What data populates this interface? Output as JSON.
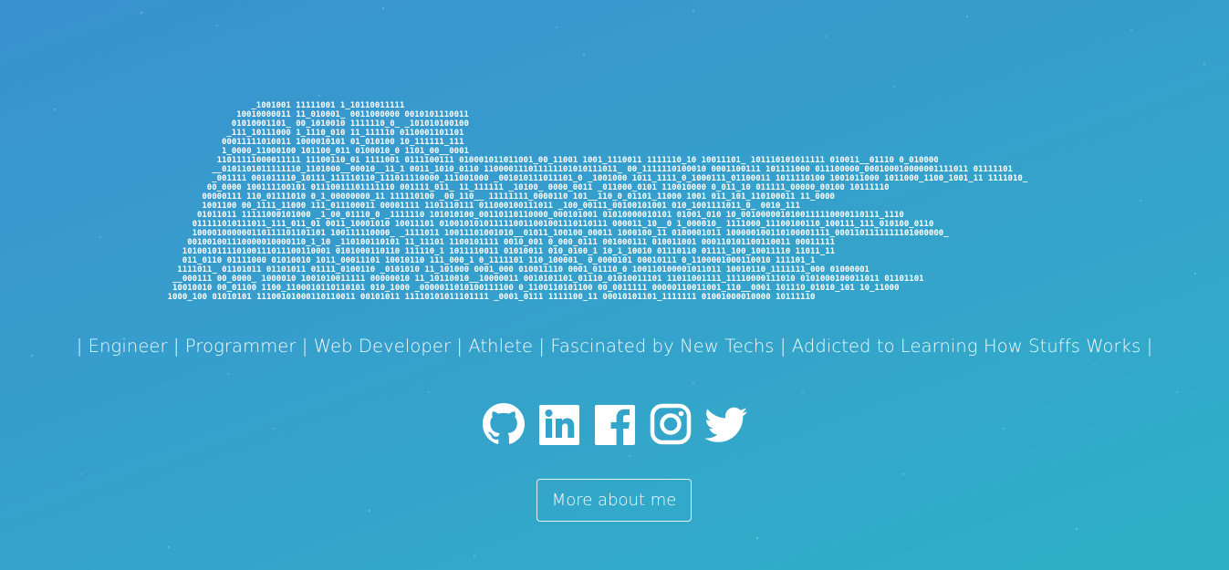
{
  "tagline": {
    "text": "| Engineer | Programmer | Web Developer | Athlete | Fascinated by New Techs | Addicted to Learning How Stuffs Works |"
  },
  "social": [
    {
      "name": "github-icon"
    },
    {
      "name": "linkedin-icon"
    },
    {
      "name": "facebook-icon"
    },
    {
      "name": "instagram-icon"
    },
    {
      "name": "twitter-icon"
    }
  ],
  "button": {
    "label": "More about me"
  },
  "colors": {
    "background_start": "#3a92cf",
    "background_end": "#2eb1c8",
    "text": "#ffffff"
  }
}
